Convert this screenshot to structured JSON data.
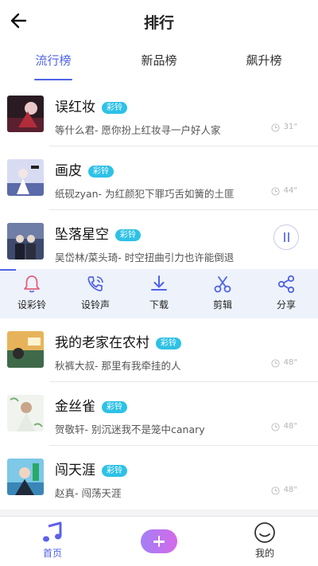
{
  "header": {
    "title": "排行",
    "back_icon": "arrow-left-icon"
  },
  "tabs": [
    {
      "label": "流行榜",
      "active": true
    },
    {
      "label": "新品榜",
      "active": false
    },
    {
      "label": "飙升榜",
      "active": false
    }
  ],
  "songs": [
    {
      "title": "误红妆",
      "badge": "彩铃",
      "subtitle": "等什么君- 愿你扮上红妆寻一户好人家",
      "duration": "31\""
    },
    {
      "title": "画皮",
      "badge": "彩铃",
      "subtitle": "纸砚zyan- 为红颜犯下罪巧舌如簧的土匪",
      "duration": "44\""
    },
    {
      "title": "坠落星空",
      "badge": "彩铃",
      "subtitle": "吴岱林/菜头琦-  时空扭曲引力也许能倒退",
      "playing": true
    },
    {
      "title": "我的老家在农村",
      "badge": "彩铃",
      "subtitle": "秋裤大叔- 那里有我牵挂的人",
      "duration": "48\""
    },
    {
      "title": "金丝雀",
      "badge": "彩铃",
      "subtitle": "贺敬轩- 别沉迷我不是笼中canary",
      "duration": "48\""
    },
    {
      "title": "闯天涯",
      "badge": "彩铃",
      "subtitle": "赵真-  闯荡天涯",
      "duration": "48\""
    }
  ],
  "actions": [
    {
      "label": "设彩铃",
      "icon": "bell-icon",
      "color": "#e0607e"
    },
    {
      "label": "设铃声",
      "icon": "phone-ring-icon",
      "color": "#4f63e8"
    },
    {
      "label": "下载",
      "icon": "download-icon",
      "color": "#4f63e8"
    },
    {
      "label": "剪辑",
      "icon": "scissors-icon",
      "color": "#4f63e8"
    },
    {
      "label": "分享",
      "icon": "share-icon",
      "color": "#4f63e8"
    }
  ],
  "bottom_nav": [
    {
      "label": "首页",
      "icon": "music-note-icon",
      "active": true
    },
    {
      "label": "",
      "icon": "plus-icon"
    },
    {
      "label": "我的",
      "icon": "smiley-icon",
      "active": false
    }
  ],
  "colors": {
    "accent": "#4f63e8",
    "badge": "#2ec1e6"
  }
}
